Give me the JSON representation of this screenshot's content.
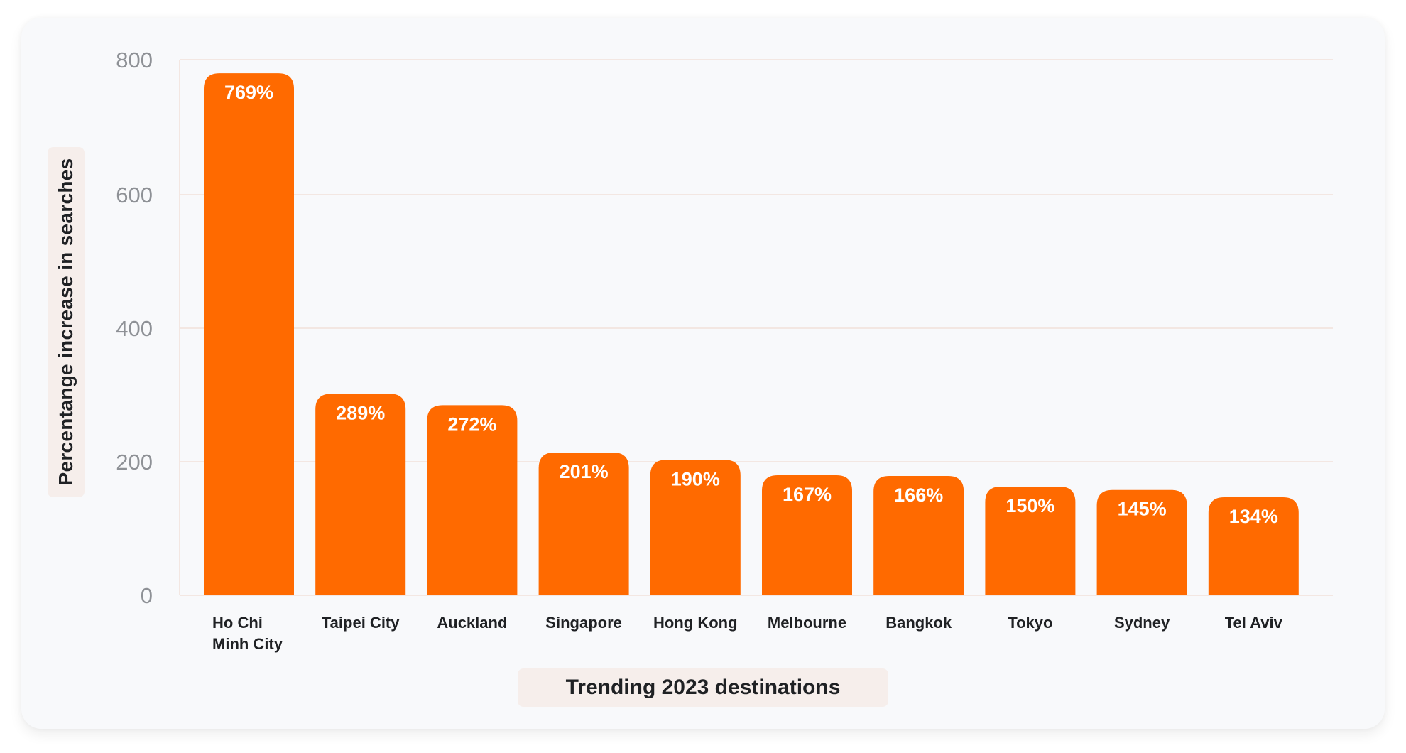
{
  "chart_data": {
    "type": "bar",
    "title": "",
    "xlabel": "Trending 2023 destinations",
    "ylabel": "Percentange increase in searches",
    "categories": [
      "Ho Chi Minh City",
      "Taipei City",
      "Auckland",
      "Singapore",
      "Hong Kong",
      "Melbourne",
      "Bangkok",
      "Tokyo",
      "Sydney",
      "Tel Aviv"
    ],
    "category_lines": [
      [
        "Ho Chi",
        "Minh City"
      ],
      [
        "Taipei City"
      ],
      [
        "Auckland"
      ],
      [
        "Singapore"
      ],
      [
        "Hong Kong"
      ],
      [
        "Melbourne"
      ],
      [
        "Bangkok"
      ],
      [
        "Tokyo"
      ],
      [
        "Sydney"
      ],
      [
        "Tel Aviv"
      ]
    ],
    "values": [
      769,
      289,
      272,
      201,
      190,
      167,
      166,
      150,
      145,
      134
    ],
    "data_labels": [
      "769%",
      "289%",
      "272%",
      "201%",
      "190%",
      "167%",
      "166%",
      "150%",
      "145%",
      "134%"
    ],
    "ylim": [
      0,
      800
    ],
    "yticks": [
      0,
      200,
      400,
      600,
      800
    ],
    "grid": true,
    "legend": "none",
    "bar_color": "#ff6a00"
  }
}
